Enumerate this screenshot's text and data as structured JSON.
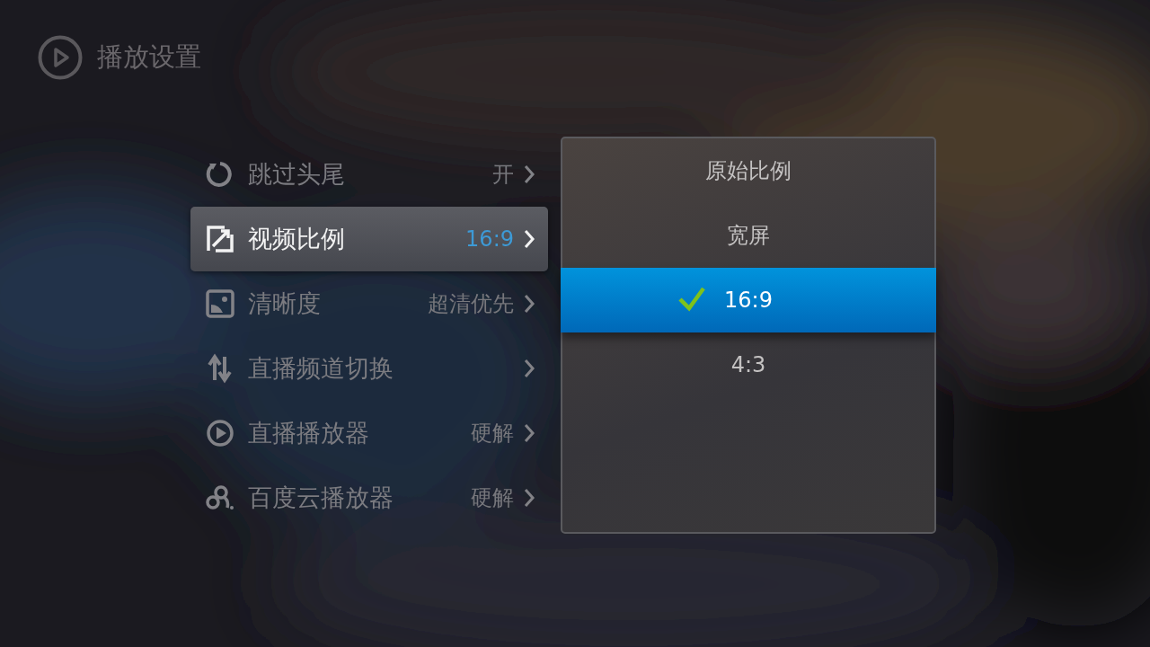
{
  "header": {
    "title": "播放设置"
  },
  "menu": [
    {
      "kind": "skip",
      "label": "跳过头尾",
      "value": "开",
      "selected": false
    },
    {
      "kind": "ratio",
      "label": "视频比例",
      "value": "16:9",
      "selected": true
    },
    {
      "kind": "quality",
      "label": "清晰度",
      "value": "超清优先",
      "selected": false
    },
    {
      "kind": "switch",
      "label": "直播频道切换",
      "selected": false
    },
    {
      "kind": "play",
      "label": "直播播放器",
      "value": "硬解",
      "selected": false
    },
    {
      "kind": "cloud",
      "label": "百度云播放器",
      "value": "硬解",
      "selected": false
    }
  ],
  "options": [
    {
      "label": "原始比例",
      "selected": false
    },
    {
      "label": "宽屏",
      "selected": false
    },
    {
      "label": "16:9",
      "selected": true
    },
    {
      "label": "4:3",
      "selected": false
    }
  ]
}
